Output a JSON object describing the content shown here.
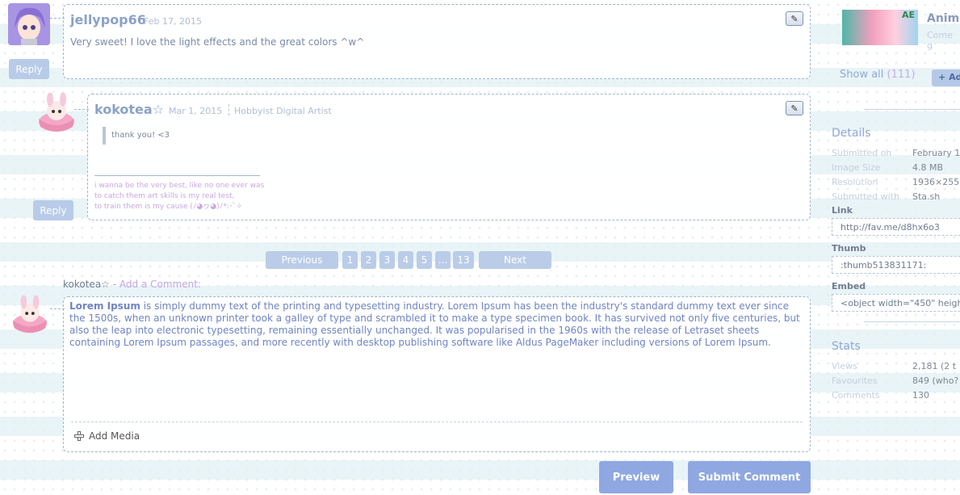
{
  "comment1": {
    "username": "jellypop66",
    "date": "Feb 17, 2015",
    "text": "Very sweet! I love the light effects and the great colors ^w^",
    "reply_label": "Reply"
  },
  "comment2": {
    "username": "kokotea",
    "star": "☆",
    "date": "Mar 1, 2015",
    "role": "Hobbyist Digital Artist",
    "text": "thank you! <3",
    "signature": [
      "i wanna be the very best, like no one ever was",
      "to catch them art skills is my real test,",
      "to train them is my cause (ﾉ◕ヮ◕)ﾉ*:･ﾟ✧"
    ],
    "reply_label": "Reply"
  },
  "pagination": {
    "previous": "Previous",
    "pages": [
      "1",
      "2",
      "3",
      "4",
      "5",
      "...",
      "13"
    ],
    "next": "Next"
  },
  "add_comment": {
    "username": "kokotea",
    "star": "☆",
    "separator": "-",
    "label": "Add a Comment:",
    "text_bold": "Lorem Ipsum",
    "text_rest": " is simply dummy text of the printing and typesetting industry. Lorem Ipsum has been the industry's standard dummy text ever since the 1500s, when an unknown printer took a galley of type and scrambled it to make a type specimen book. It has survived not only five centuries, but also the leap into electronic typesetting, remaining essentially unchanged. It was popularised in the 1960s with the release of Letraset sheets containing Lorem Ipsum passages, and more recently with desktop publishing software like Aldus PageMaker including versions of Lorem Ipsum.",
    "add_media": "Add Media",
    "preview": "Preview",
    "submit": "Submit Comment"
  },
  "sidebar": {
    "group_title": "Anime",
    "group_sub": "Come g",
    "group_thumb_badge": "AE",
    "show_all": "Show all",
    "show_all_count": "(111)",
    "add_button": "Ad",
    "details_title": "Details",
    "details": [
      {
        "label": "Submitted on",
        "value": "February 1"
      },
      {
        "label": "Image Size",
        "value": "4.8 MB"
      },
      {
        "label": "Resolution",
        "value": "1936×255"
      },
      {
        "label": "Submitted with",
        "value": "Sta.sh"
      }
    ],
    "link_label": "Link",
    "link_value": "http://fav.me/d8hx6o3",
    "thumb_label": "Thumb",
    "thumb_value": ":thumb513831171:",
    "embed_label": "Embed",
    "embed_value": "<object width=\"450\" height",
    "stats_title": "Stats",
    "stats": [
      {
        "label": "Views",
        "value": "2,181 (2 t"
      },
      {
        "label": "Favourites",
        "value": "849 (who?"
      },
      {
        "label": "Comments",
        "value": "130"
      }
    ]
  },
  "colors": {
    "accent": "#8ba2c6",
    "button": "#8fa8e2",
    "border": "#9fb6cc"
  }
}
